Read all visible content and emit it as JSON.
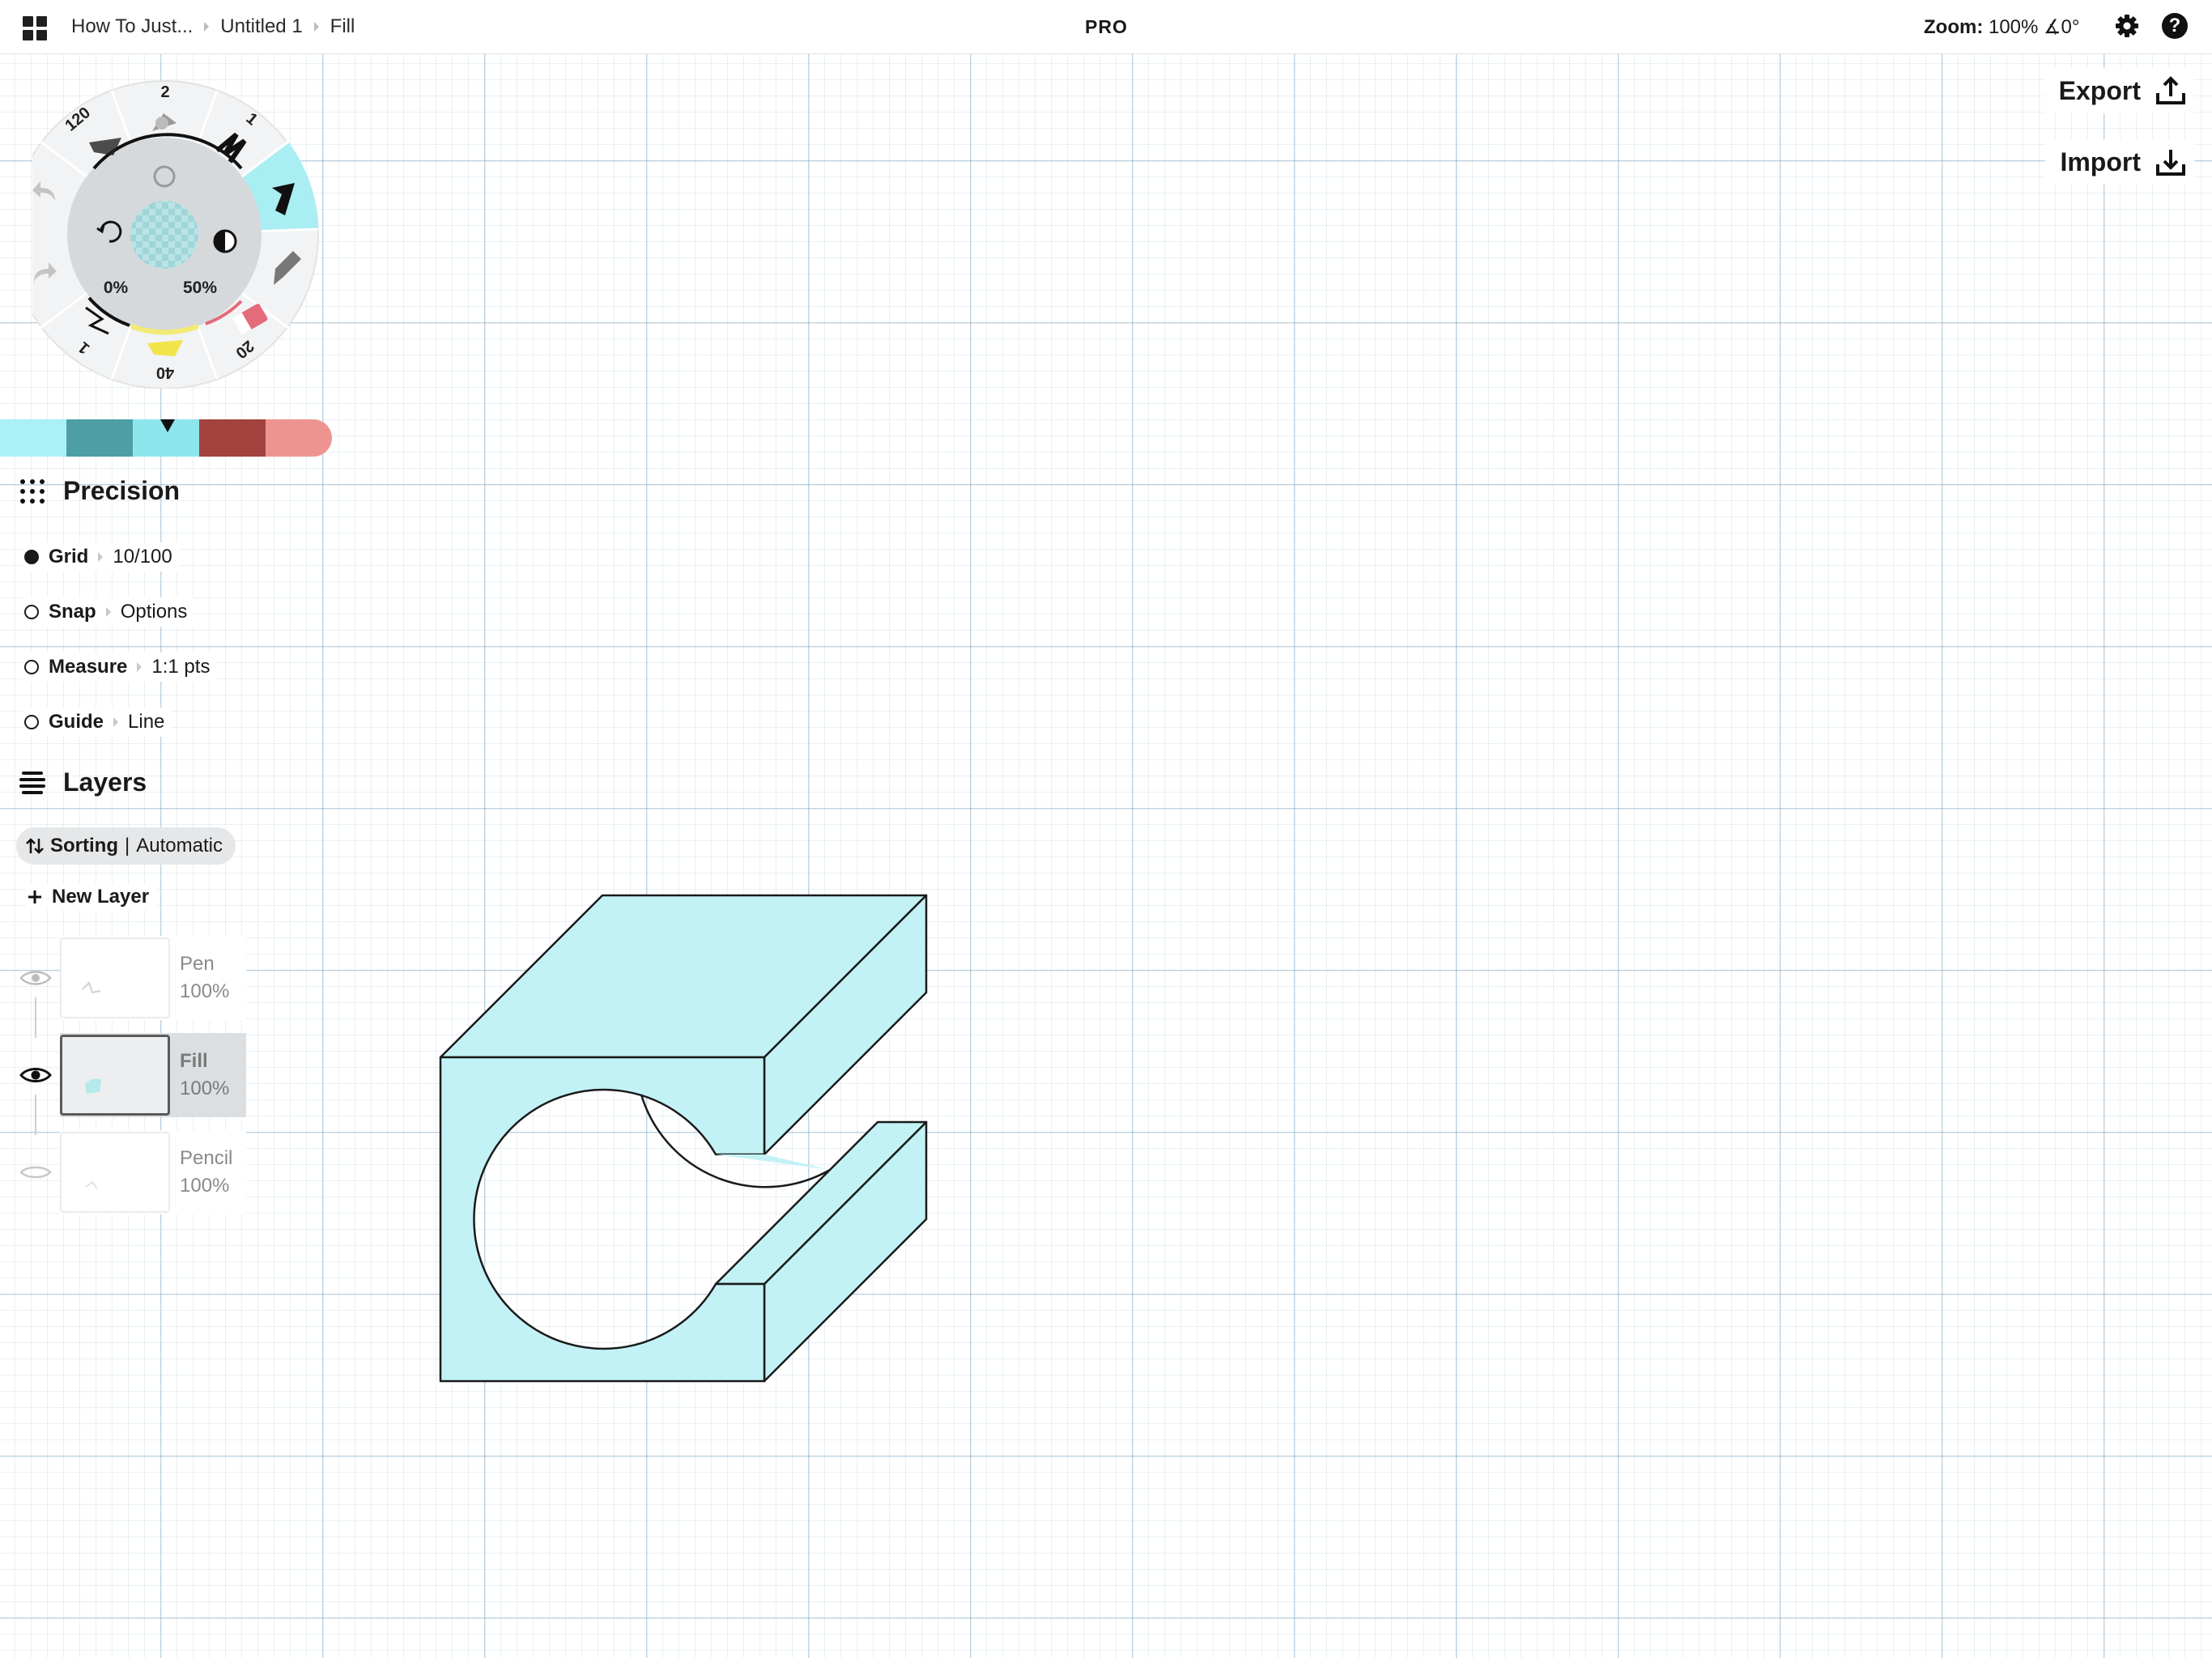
{
  "topbar": {
    "breadcrumbs": [
      "How To Just...",
      "Untitled 1",
      "Fill"
    ],
    "badge": "PRO",
    "zoom_label": "Zoom:",
    "zoom_value": "100% ∡0°"
  },
  "side_actions": {
    "export_label": "Export",
    "import_label": "Import"
  },
  "tool_wheel": {
    "tool_sizes": [
      "2",
      "1",
      "20",
      "40",
      "1",
      "120"
    ],
    "opacity_label": "0%",
    "smoothing_label": "50%",
    "selected_tool": "pen"
  },
  "palette": {
    "colors": [
      "#a9f1f6",
      "#4e9ea5",
      "#8de6ec",
      "#a3423e",
      "#ee9490"
    ],
    "selected_index": 2
  },
  "precision": {
    "title": "Precision",
    "rows": [
      {
        "label": "Grid",
        "value": "10/100",
        "on": true
      },
      {
        "label": "Snap",
        "value": "Options",
        "on": false
      },
      {
        "label": "Measure",
        "value": "1:1 pts",
        "on": false
      },
      {
        "label": "Guide",
        "value": "Line",
        "on": false
      }
    ]
  },
  "layers": {
    "title": "Layers",
    "sorting_label": "Sorting",
    "sorting_value": "Automatic",
    "new_layer_label": "New Layer",
    "items": [
      {
        "name": "Pen",
        "opacity": "100%",
        "visible": "dim"
      },
      {
        "name": "Fill",
        "opacity": "100%",
        "visible": "on",
        "selected": true
      },
      {
        "name": "Pencil",
        "opacity": "100%",
        "visible": "off"
      }
    ]
  },
  "canvas": {
    "fill_color": "#c2f2f5",
    "stroke_color": "#1a1a1a"
  }
}
